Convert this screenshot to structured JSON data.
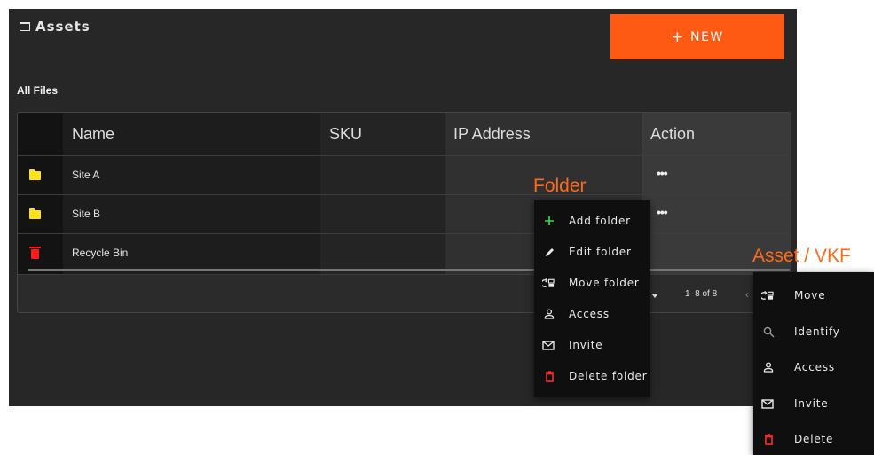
{
  "app": {
    "title": "Assets"
  },
  "toolbar": {
    "new_label": "NEW"
  },
  "section": {
    "label": "All Files"
  },
  "table": {
    "columns": [
      "Name",
      "SKU",
      "IP Address",
      "Action"
    ],
    "rows": [
      {
        "icon": "folder-icon",
        "name": "Site A",
        "sku": "",
        "ip": "",
        "action": "•••"
      },
      {
        "icon": "folder-icon",
        "name": "Site B",
        "sku": "",
        "ip": "",
        "action": "•••"
      },
      {
        "icon": "trash-icon",
        "name": "Recycle Bin",
        "sku": "",
        "ip": "",
        "action": ""
      }
    ],
    "pagination": {
      "range": "1–8 of 8"
    }
  },
  "folder_menu": {
    "title": "Folder",
    "items": [
      {
        "label": "Add folder",
        "icon": "plus-icon",
        "color": "#3ddc4a"
      },
      {
        "label": "Edit folder",
        "icon": "pencil-icon",
        "color": "#eaeaea"
      },
      {
        "label": "Move folder",
        "icon": "move-icon",
        "color": "#eaeaea"
      },
      {
        "label": "Access",
        "icon": "person-icon",
        "color": "#eaeaea"
      },
      {
        "label": "Invite",
        "icon": "mail-icon",
        "color": "#eaeaea"
      },
      {
        "label": "Delete folder",
        "icon": "trash-icon",
        "color": "#ff2a2a"
      }
    ]
  },
  "asset_menu": {
    "title": "Asset / VKF",
    "items": [
      {
        "label": "Move",
        "icon": "move-icon",
        "color": "#eaeaea"
      },
      {
        "label": "Identify",
        "icon": "search-icon",
        "color": "#9a9a9a"
      },
      {
        "label": "Access",
        "icon": "person-icon",
        "color": "#eaeaea"
      },
      {
        "label": "Invite",
        "icon": "mail-icon",
        "color": "#eaeaea"
      },
      {
        "label": "Delete",
        "icon": "trash-icon",
        "color": "#ff2a2a"
      }
    ]
  }
}
